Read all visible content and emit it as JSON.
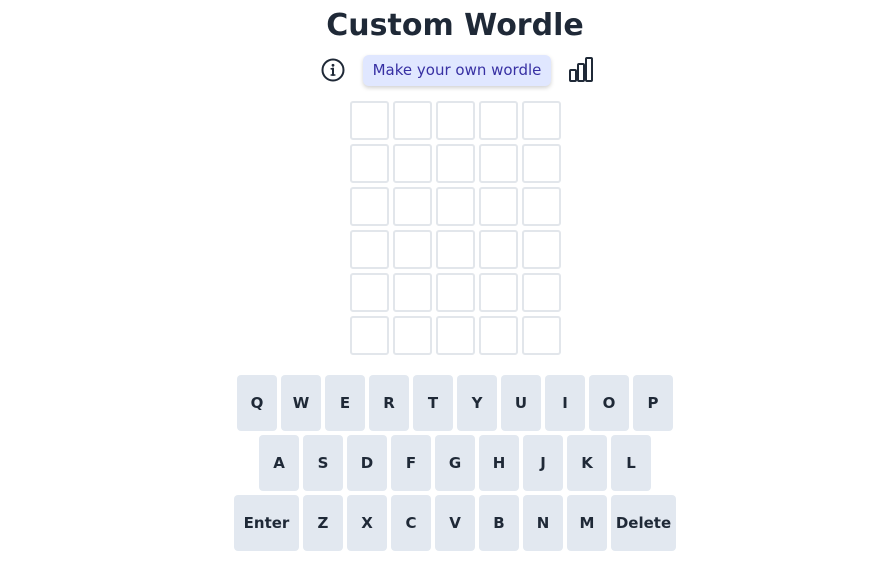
{
  "header": {
    "title": "Custom Wordle"
  },
  "toolbar": {
    "info_icon": "info-circle-icon",
    "make_button_label": "Make your own wordle",
    "stats_icon": "bar-chart-icon"
  },
  "board": {
    "rows": [
      [
        "",
        "",
        "",
        "",
        ""
      ],
      [
        "",
        "",
        "",
        "",
        ""
      ],
      [
        "",
        "",
        "",
        "",
        ""
      ],
      [
        "",
        "",
        "",
        "",
        ""
      ],
      [
        "",
        "",
        "",
        "",
        ""
      ],
      [
        "",
        "",
        "",
        "",
        ""
      ]
    ]
  },
  "keyboard": {
    "rows": [
      [
        "Q",
        "W",
        "E",
        "R",
        "T",
        "Y",
        "U",
        "I",
        "O",
        "P"
      ],
      [
        "A",
        "S",
        "D",
        "F",
        "G",
        "H",
        "J",
        "K",
        "L"
      ],
      [
        "Enter",
        "Z",
        "X",
        "C",
        "V",
        "B",
        "N",
        "M",
        "Delete"
      ]
    ]
  },
  "colors": {
    "key_background": "#e2e8f0",
    "tile_border": "#e2e6eb",
    "button_background": "#e0e7ff",
    "button_text": "#3730a3",
    "text": "#1f2937"
  }
}
